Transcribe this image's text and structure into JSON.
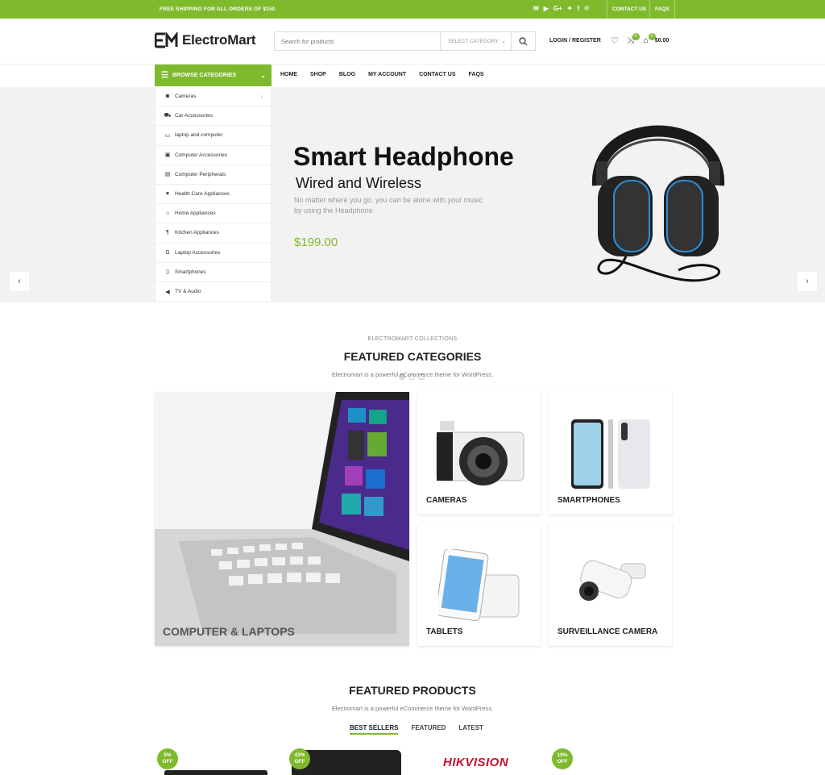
{
  "topbar": {
    "shipping": "FREE SHIPPING FOR ALL ORDERS OF $150",
    "social_icons": [
      "mail-icon",
      "youtube-icon",
      "google-plus-icon",
      "twitter-icon",
      "facebook-icon",
      "pinterest-icon"
    ],
    "google_plus_text": "G+",
    "contact": "CONTACT US",
    "faqs": "FAQS"
  },
  "header": {
    "logo": "ElectroMart",
    "search_placeholder": "Search for products",
    "select_category": "SELECT CATEGORY",
    "login": "LOGIN / REGISTER",
    "compare_count": "0",
    "cart_count": "0",
    "cart_total": "$0.00"
  },
  "nav": {
    "browse": "BROWSE CATEGORIES",
    "items": [
      "HOME",
      "SHOP",
      "BLOG",
      "MY ACCOUNT",
      "CONTACT US",
      "FAQS"
    ]
  },
  "categories": [
    {
      "label": "Cameras",
      "icon": "camera-icon",
      "glyph": "◙"
    },
    {
      "label": "Car Accessories",
      "icon": "car-icon",
      "glyph": "⛟"
    },
    {
      "label": "laptop and computer",
      "icon": "laptop-icon",
      "glyph": "▭"
    },
    {
      "label": "Computer Accessories",
      "icon": "monitor-icon",
      "glyph": "▣"
    },
    {
      "label": "Computer Peripherals",
      "icon": "keyboard-icon",
      "glyph": "▤"
    },
    {
      "label": "Health Care Appliances",
      "icon": "heart-icon",
      "glyph": "♥"
    },
    {
      "label": "Home Appliances",
      "icon": "home-icon",
      "glyph": "⌂"
    },
    {
      "label": "Kitchen Appliances",
      "icon": "utensils-icon",
      "glyph": "¶"
    },
    {
      "label": "Laptop Accessories",
      "icon": "headset-icon",
      "glyph": "Ω"
    },
    {
      "label": "Smartphones",
      "icon": "phone-icon",
      "glyph": "▯"
    },
    {
      "label": "TV & Audio",
      "icon": "speaker-icon",
      "glyph": "◀"
    }
  ],
  "hero": {
    "title": "Smart Headphone",
    "subtitle": "Wired and Wireless",
    "desc": "No matter where you go, you can be alone with your music by using the Headphone",
    "price": "$199.00"
  },
  "collections": {
    "eyebrow": "ELECTROMART COLLECTIONS",
    "title": "FEATURED CATEGORIES",
    "desc": "Electromart is a powerful eCommerce theme for WordPress.",
    "tiles": [
      "COMPUTER & LAPTOPS",
      "CAMERAS",
      "SMARTPHONES",
      "TABLETS",
      "SURVEILLANCE CAMERA"
    ]
  },
  "products": {
    "title": "FEATURED PRODUCTS",
    "desc": "Electromart is a powerful eCommerce theme for WordPress.",
    "tabs": [
      "BEST SELLERS",
      "FEATURED",
      "LATEST"
    ],
    "badges": [
      "5%",
      "43%",
      "19%"
    ],
    "off": "OFF",
    "brand": "HIKVISION"
  },
  "colors": {
    "accent": "#7fba2d"
  }
}
